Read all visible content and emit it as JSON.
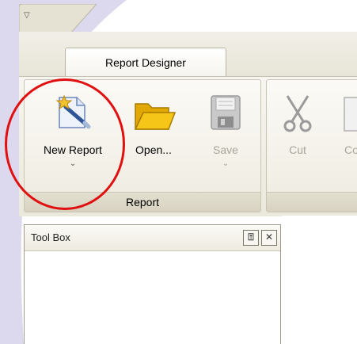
{
  "quick_access": {
    "arrow_glyph": "▽"
  },
  "tabs": [
    {
      "label": "Report Designer",
      "selected": true
    }
  ],
  "ribbon": {
    "groups": [
      {
        "caption": "Report",
        "buttons": [
          {
            "label": "New Report",
            "dropdown": "⌄",
            "icon": "new-report-wand-icon",
            "enabled": true
          },
          {
            "label": "Open...",
            "icon": "open-folder-icon",
            "enabled": true
          },
          {
            "label": "Save",
            "dropdown": "⌄",
            "icon": "save-disk-icon",
            "enabled": false
          }
        ]
      },
      {
        "caption": "",
        "buttons": [
          {
            "label": "Cut",
            "icon": "scissors-icon",
            "enabled": false
          },
          {
            "label": "Co",
            "icon": "copy-icon",
            "enabled": false
          }
        ]
      }
    ]
  },
  "toolbox": {
    "title": "Tool Box",
    "pin_glyph": "⍐",
    "close_glyph": "✕"
  },
  "colors": {
    "highlight": "#e01010",
    "swoosh": "#dcd9ee",
    "folder": "#f5c518"
  }
}
